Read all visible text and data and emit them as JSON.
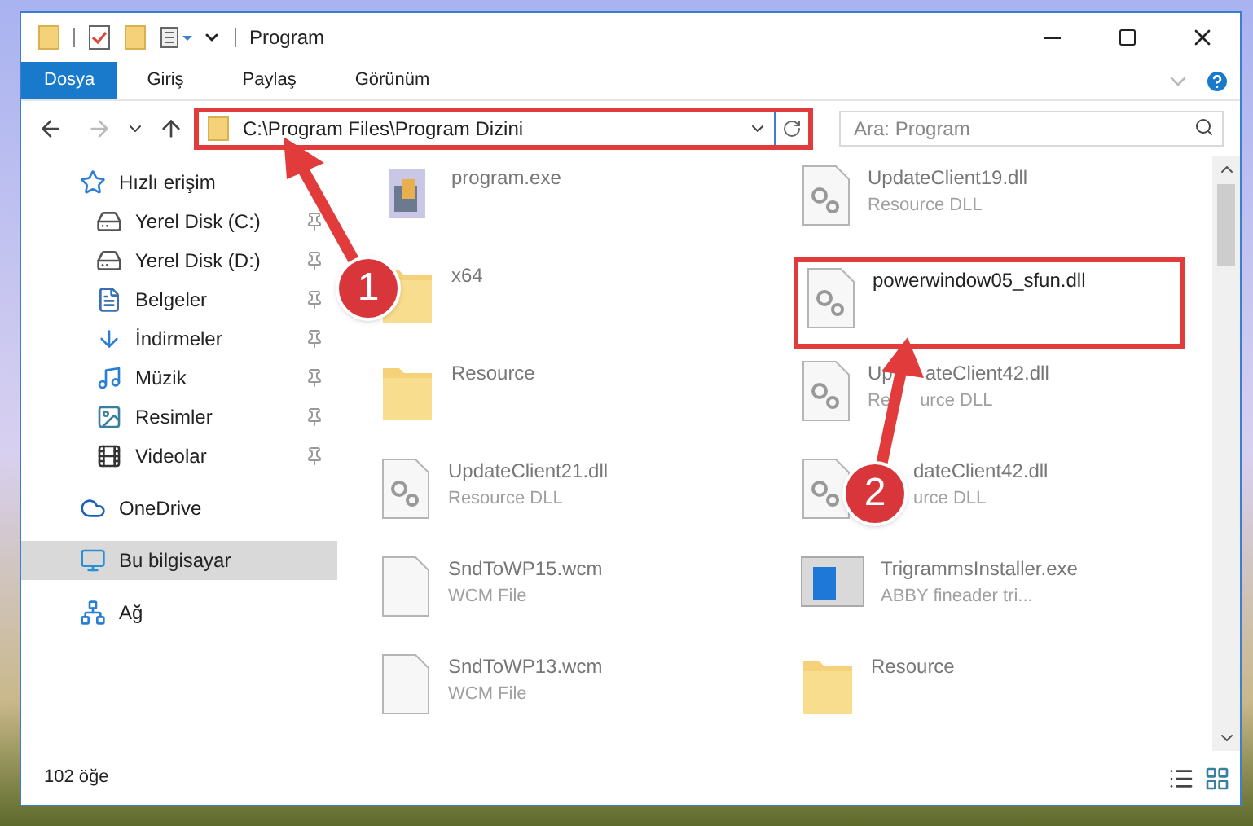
{
  "window": {
    "title": "Program"
  },
  "ribbon_tabs": [
    {
      "label": "Dosya",
      "kind": "file"
    },
    {
      "label": "Giriş",
      "kind": "tab"
    },
    {
      "label": "Paylaş",
      "kind": "tab"
    },
    {
      "label": "Görünüm",
      "kind": "tab"
    }
  ],
  "address_bar": {
    "path": "C:\\Program Files\\Program Dizini",
    "annotated": true
  },
  "search": {
    "placeholder": "Ara: Program"
  },
  "sidebar": {
    "items": [
      {
        "label": "Hızlı erişim",
        "kind": "star",
        "selected": false,
        "children": [
          {
            "label": "Yerel Disk (C:)",
            "kind": "drive",
            "pinned": true,
            "selected": false
          },
          {
            "label": "Yerel Disk (D:)",
            "kind": "drive",
            "pinned": true,
            "selected": false
          },
          {
            "label": "Belgeler",
            "kind": "document",
            "pinned": true,
            "selected": false
          },
          {
            "label": "İndirmeler",
            "kind": "download",
            "pinned": true,
            "selected": false
          },
          {
            "label": "Müzik",
            "kind": "music",
            "pinned": true,
            "selected": false
          },
          {
            "label": "Resimler",
            "kind": "picture",
            "pinned": true,
            "selected": false
          },
          {
            "label": "Videolar",
            "kind": "video",
            "pinned": true,
            "selected": false
          }
        ]
      },
      {
        "label": "OneDrive",
        "kind": "cloud",
        "selected": false
      },
      {
        "label": "Bu bilgisayar",
        "kind": "computer",
        "selected": true
      },
      {
        "label": "Ağ",
        "kind": "network",
        "selected": false
      }
    ]
  },
  "files": [
    {
      "name": [
        "program.exe"
      ],
      "kind": "exe",
      "annotated": false
    },
    {
      "name": [
        "UpdateClient19.dll"
      ],
      "type": [
        "Resource DLL"
      ],
      "kind": "dll",
      "annotated": false
    },
    {
      "name": [
        "x64"
      ],
      "kind": "folder",
      "annotated": false
    },
    {
      "name": [
        "powerwindow05_sfun.dll"
      ],
      "kind": "dll",
      "annotated": true
    },
    {
      "name": [
        "Resource"
      ],
      "kind": "folder",
      "annotated": false
    },
    {
      "name": [
        "Up",
        "ateClient42.dll"
      ],
      "type": [
        "Re",
        "urce DLL"
      ],
      "kind": "dll",
      "annotated": false
    },
    {
      "name": [
        "UpdateClient21.dll"
      ],
      "type": [
        "Resource DLL"
      ],
      "kind": "dll",
      "annotated": false
    },
    {
      "name": [
        "dateClient42.dll"
      ],
      "type": [
        "urce DLL"
      ],
      "kind": "dll",
      "annotated": false
    },
    {
      "name": [
        "SndToWP15.wcm"
      ],
      "type": [
        "WCM File"
      ],
      "kind": "file",
      "annotated": false
    },
    {
      "name": [
        "TrigrammsInstaller.exe"
      ],
      "type": [
        "ABBY fineader tri..."
      ],
      "kind": "installer",
      "annotated": false
    },
    {
      "name": [
        "SndToWP13.wcm"
      ],
      "type": [
        "WCM File"
      ],
      "kind": "file",
      "annotated": false
    },
    {
      "name": [
        "Resource"
      ],
      "kind": "folder",
      "annotated": false
    }
  ],
  "status_bar": {
    "count": "102 öğe"
  },
  "annotations": [
    {
      "number": "1"
    },
    {
      "number": "2"
    }
  ]
}
